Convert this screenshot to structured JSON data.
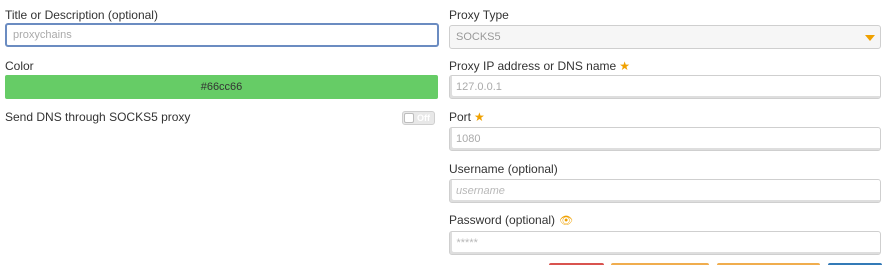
{
  "left": {
    "title_label": "Title or Description (optional)",
    "title_value": "proxychains",
    "color_label": "Color",
    "color_value": "#66cc66",
    "dns_label": "Send DNS through SOCKS5 proxy",
    "dns_toggle": "Off"
  },
  "right": {
    "type_label": "Proxy Type",
    "type_value": "SOCKS5",
    "ip_label": "Proxy IP address or DNS name",
    "ip_placeholder": "127.0.0.1",
    "port_label": "Port",
    "port_placeholder": "1080",
    "username_label": "Username (optional)",
    "username_placeholder": "username",
    "password_label": "Password (optional)",
    "password_placeholder": "*****"
  },
  "colors": {
    "accent": "#f0a100",
    "focus_border": "#6b8cc1",
    "swatch": "#66cc66",
    "button_red": "#d9534f",
    "button_orange": "#f0ad4e",
    "button_blue": "#337ab7"
  },
  "icons": {
    "required": "star-icon",
    "reveal": "eye-icon",
    "dropdown": "caret-down-icon"
  }
}
